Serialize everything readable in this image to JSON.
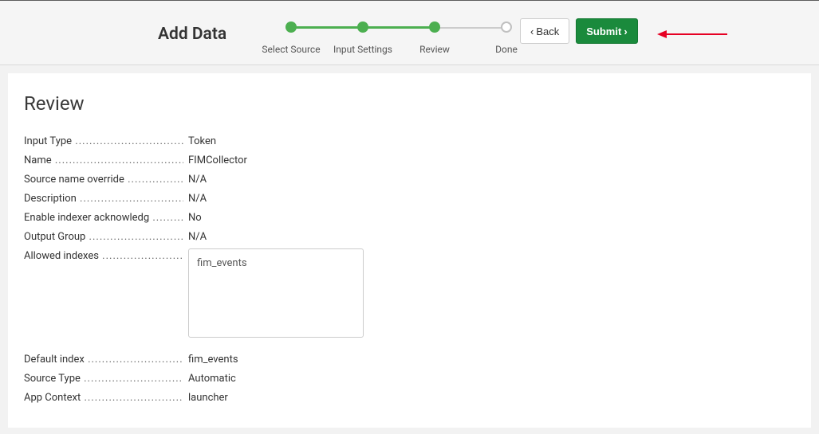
{
  "header": {
    "title": "Add Data",
    "steps": [
      {
        "label": "Select Source",
        "state": "done"
      },
      {
        "label": "Input Settings",
        "state": "done"
      },
      {
        "label": "Review",
        "state": "active"
      },
      {
        "label": "Done",
        "state": "inactive"
      }
    ],
    "back_label": "Back",
    "submit_label": "Submit"
  },
  "review": {
    "title": "Review",
    "fields": {
      "input_type": {
        "label": "Input Type",
        "value": "Token"
      },
      "name": {
        "label": "Name",
        "value": "FIMCollector"
      },
      "source_name_override": {
        "label": "Source name override",
        "value": "N/A"
      },
      "description": {
        "label": "Description",
        "value": "N/A"
      },
      "enable_indexer_ack": {
        "label": "Enable indexer acknowledg",
        "value": "No"
      },
      "output_group": {
        "label": "Output Group",
        "value": "N/A"
      },
      "allowed_indexes": {
        "label": "Allowed indexes",
        "value": "fim_events"
      },
      "default_index": {
        "label": "Default index",
        "value": "fim_events"
      },
      "source_type": {
        "label": "Source Type",
        "value": "Automatic"
      },
      "app_context": {
        "label": "App Context",
        "value": "launcher"
      }
    }
  },
  "colors": {
    "accent_green": "#1a8a3c",
    "step_green": "#4caf50",
    "annotation_red": "#e60023"
  }
}
